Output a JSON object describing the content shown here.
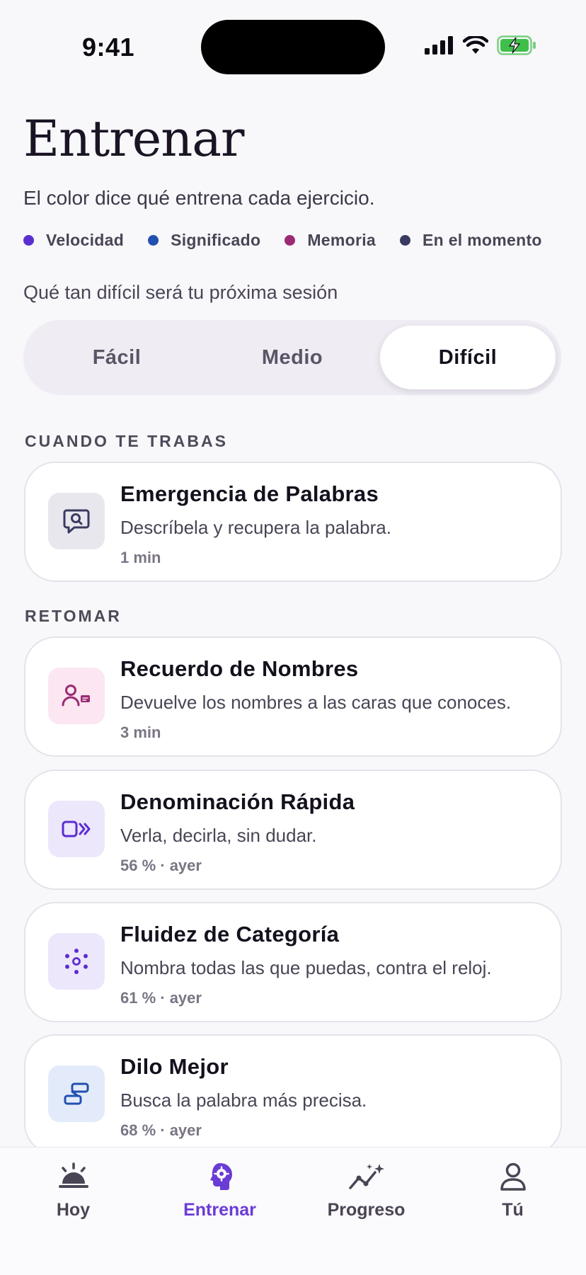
{
  "status_bar": {
    "time": "9:41"
  },
  "header": {
    "title": "Entrenar",
    "subtitle": "El color dice qué entrena cada ejercicio."
  },
  "legend": [
    {
      "label": "Velocidad",
      "color": "#5b2ed0"
    },
    {
      "label": "Significado",
      "color": "#2150b0"
    },
    {
      "label": "Memoria",
      "color": "#9b2a74"
    },
    {
      "label": "En el momento",
      "color": "#3a3a60"
    }
  ],
  "difficulty": {
    "label": "Qué tan difícil será tu próxima sesión",
    "options": [
      "Fácil",
      "Medio",
      "Difícil"
    ],
    "selected": "Difícil"
  },
  "sections": [
    {
      "header": "CUANDO TE TRABAS",
      "cards": [
        {
          "title": "Emergencia de Palabras",
          "description": "Descríbela y recupera la palabra.",
          "meta": "1 min",
          "icon": "speech-search-icon",
          "accent": "#3a3a60",
          "tint": "#e8e7ee"
        }
      ]
    },
    {
      "header": "RETOMAR",
      "cards": [
        {
          "title": "Recuerdo de Nombres",
          "description": "Devuelve los nombres a las caras que conoces.",
          "meta": "3 min",
          "icon": "person-card-icon",
          "accent": "#9b2a74",
          "tint": "#fbe6f1"
        },
        {
          "title": "Denominación Rápida",
          "description": "Verla, decirla, sin dudar.",
          "meta": "56 % · ayer",
          "icon": "fast-forward-icon",
          "accent": "#5b2ed0",
          "tint": "#ece7fb"
        },
        {
          "title": "Fluidez de Categoría",
          "description": "Nombra todas las que puedas, contra el reloj.",
          "meta": "61 % · ayer",
          "icon": "dots-circle-icon",
          "accent": "#5b2ed0",
          "tint": "#ece7fb"
        },
        {
          "title": "Dilo Mejor",
          "description": "Busca la palabra más precisa.",
          "meta": "68 % · ayer",
          "icon": "blocks-icon",
          "accent": "#2150b0",
          "tint": "#e3ebfa"
        }
      ]
    }
  ],
  "tab_bar": {
    "tabs": [
      {
        "label": "Hoy",
        "icon": "sunrise-icon"
      },
      {
        "label": "Entrenar",
        "icon": "brain-gear-icon"
      },
      {
        "label": "Progreso",
        "icon": "sparkle-chart-icon"
      },
      {
        "label": "Tú",
        "icon": "person-icon"
      }
    ],
    "active": "Entrenar",
    "active_color": "#6a3cd6"
  }
}
